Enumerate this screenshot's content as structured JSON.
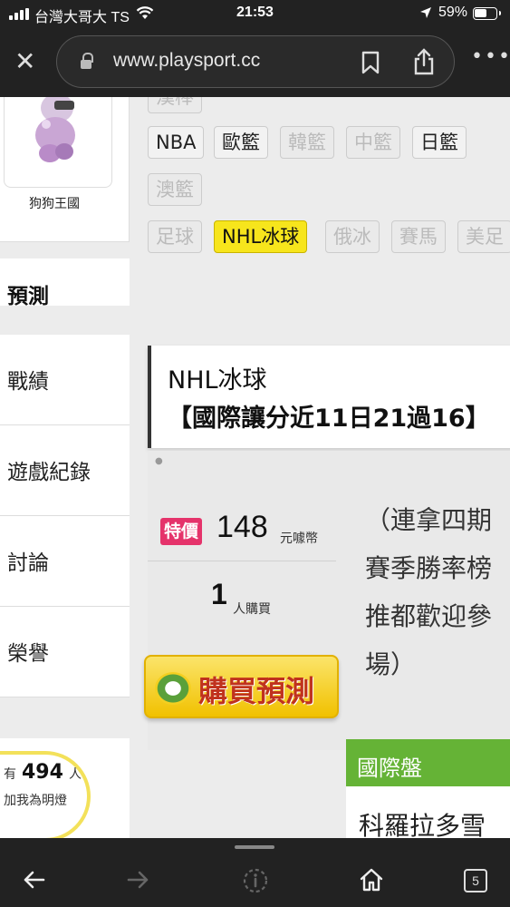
{
  "status_bar": {
    "carrier": "台灣大哥大 TS",
    "time": "21:53",
    "battery": "59%"
  },
  "browser": {
    "url": "www.playsport.cc"
  },
  "sidebar": {
    "profile_name": "狗狗王國",
    "section_title": "預測",
    "menu": [
      "戰績",
      "遊戲紀錄",
      "討論",
      "榮譽"
    ],
    "fan": {
      "prefix": "有",
      "count": "494",
      "suffix": "人",
      "subtitle": "加我為明燈"
    }
  },
  "tags": {
    "row1": [
      "NBA",
      "歐籃",
      "韓籃",
      "中籃",
      "日籃"
    ],
    "row2": [
      "澳籃"
    ],
    "row3": [
      "足球",
      "NHL冰球",
      "俄冰",
      "賽馬",
      "美足"
    ],
    "active": "NHL冰球"
  },
  "prediction": {
    "league": "NHL冰球",
    "headline": "【國際讓分近11日21過16】",
    "badge": "特價",
    "price": "148",
    "price_unit": "元噱幣",
    "buyers": "1",
    "buyers_unit": "人購買",
    "buy_button": "購買預測",
    "description": "（連拿四期\n賽季勝率榜\n推都歡迎參\n場）",
    "market_label": "國際盤",
    "team": "科羅拉多雪"
  },
  "toolbar": {
    "tab_count": "5"
  }
}
